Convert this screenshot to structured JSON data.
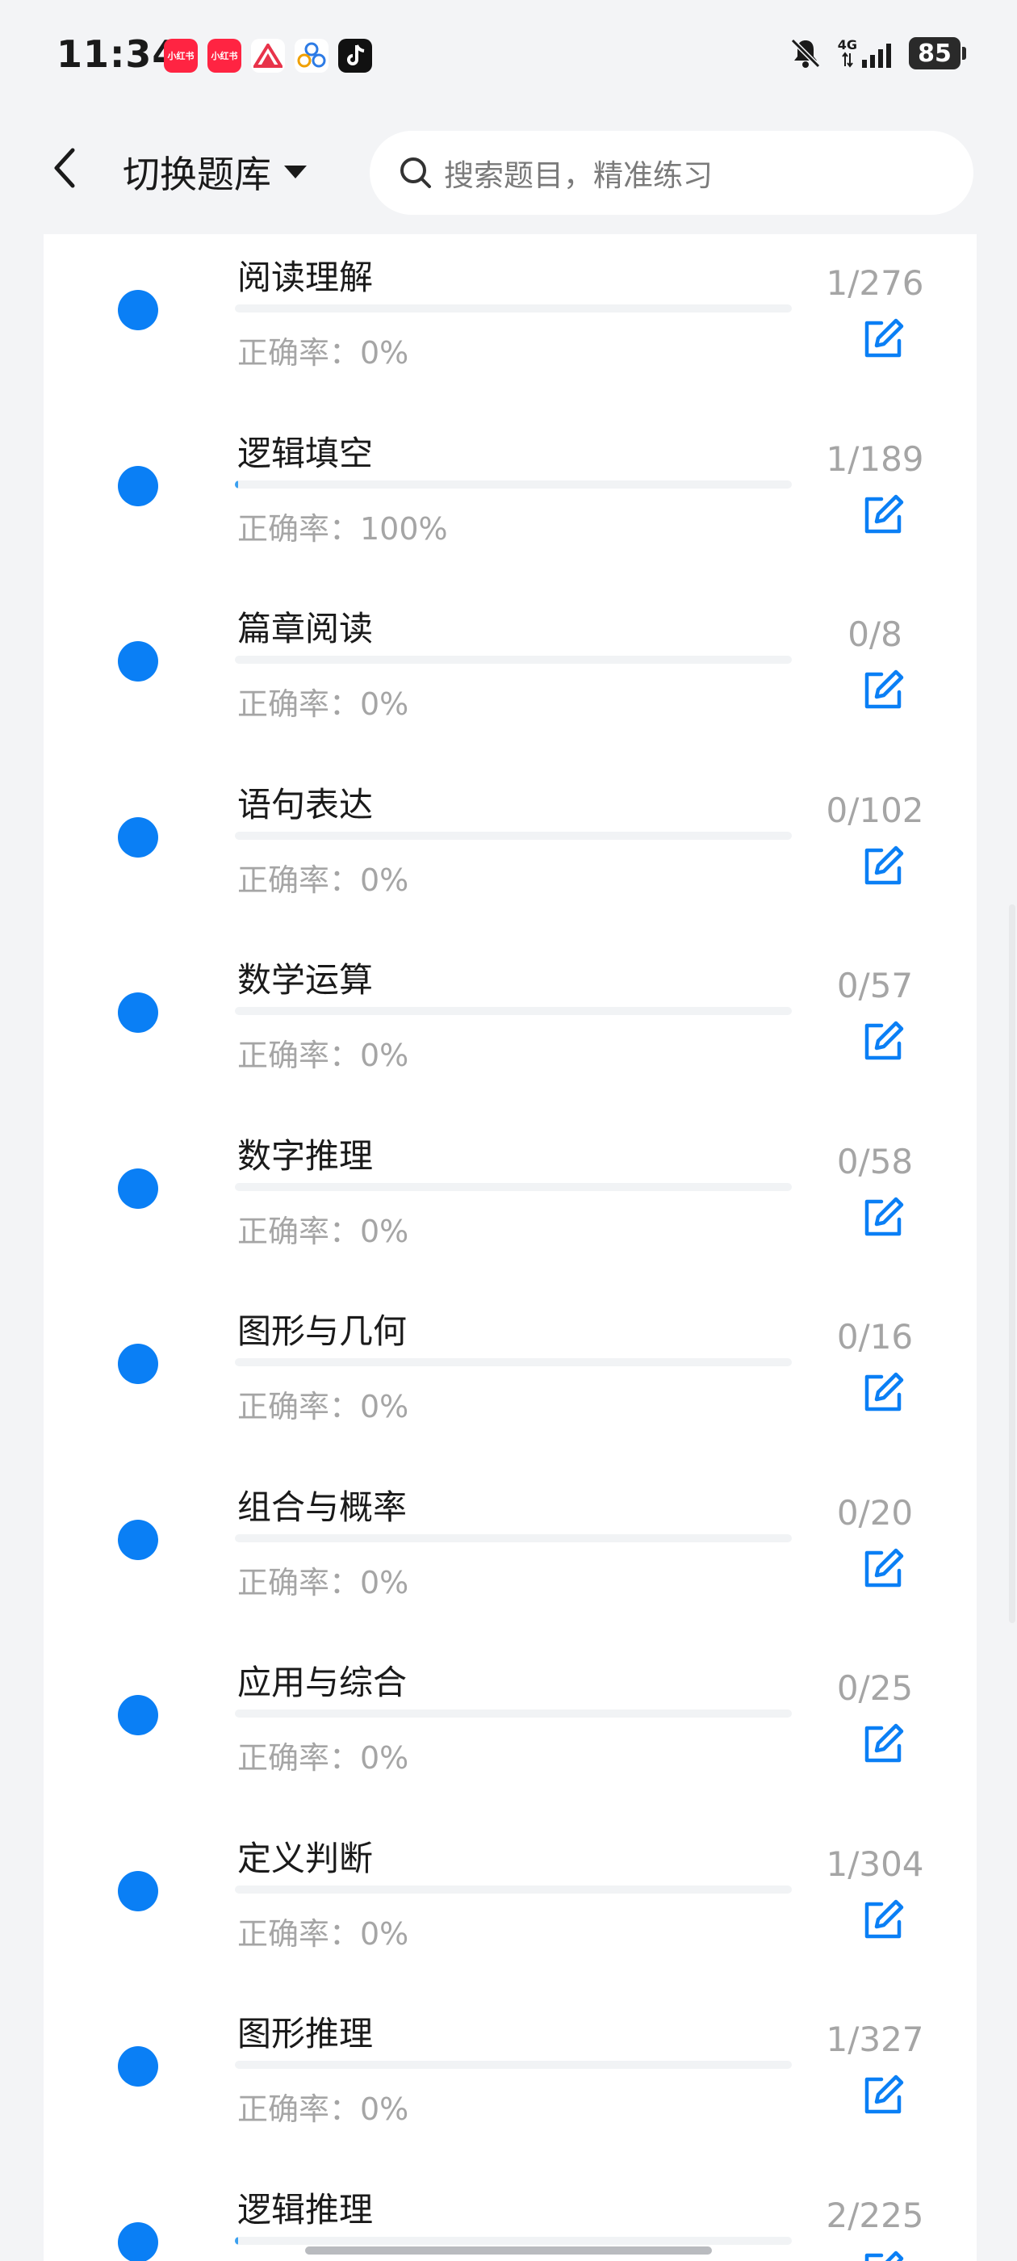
{
  "status_bar": {
    "time": "11:34",
    "network": "4G",
    "battery": "85",
    "apps": [
      {
        "name": "xiaohongshu",
        "label": "小红书",
        "color": "#ff2442"
      },
      {
        "name": "xiaohongshu-2",
        "label": "小红书",
        "color": "#ff2442"
      },
      {
        "name": "app-red-triangle",
        "label": "",
        "color": "#ffffff"
      },
      {
        "name": "app-bubbles",
        "label": "",
        "color": "#ffffff"
      },
      {
        "name": "tiktok",
        "label": "",
        "color": "#111111"
      }
    ]
  },
  "header": {
    "back_icon": "chevron-left-icon",
    "switch_label": "切换题库",
    "search_placeholder": "搜索题目，精准练习"
  },
  "accent_color": "#0a7ff5",
  "rows": [
    {
      "title": "阅读理解",
      "accuracy_label": "正确率：0%",
      "count": "1/276",
      "progress": 0
    },
    {
      "title": "逻辑填空",
      "accuracy_label": "正确率：100%",
      "count": "1/189",
      "progress": 0.005
    },
    {
      "title": "篇章阅读",
      "accuracy_label": "正确率：0%",
      "count": "0/8",
      "progress": 0
    },
    {
      "title": "语句表达",
      "accuracy_label": "正确率：0%",
      "count": "0/102",
      "progress": 0
    },
    {
      "title": "数学运算",
      "accuracy_label": "正确率：0%",
      "count": "0/57",
      "progress": 0
    },
    {
      "title": "数字推理",
      "accuracy_label": "正确率：0%",
      "count": "0/58",
      "progress": 0
    },
    {
      "title": "图形与几何",
      "accuracy_label": "正确率：0%",
      "count": "0/16",
      "progress": 0
    },
    {
      "title": "组合与概率",
      "accuracy_label": "正确率：0%",
      "count": "0/20",
      "progress": 0
    },
    {
      "title": "应用与综合",
      "accuracy_label": "正确率：0%",
      "count": "0/25",
      "progress": 0
    },
    {
      "title": "定义判断",
      "accuracy_label": "正确率：0%",
      "count": "1/304",
      "progress": 0
    },
    {
      "title": "图形推理",
      "accuracy_label": "正确率：0%",
      "count": "1/327",
      "progress": 0
    },
    {
      "title": "逻辑推理",
      "accuracy_label": "",
      "count": "2/225",
      "progress": 0.005
    }
  ]
}
